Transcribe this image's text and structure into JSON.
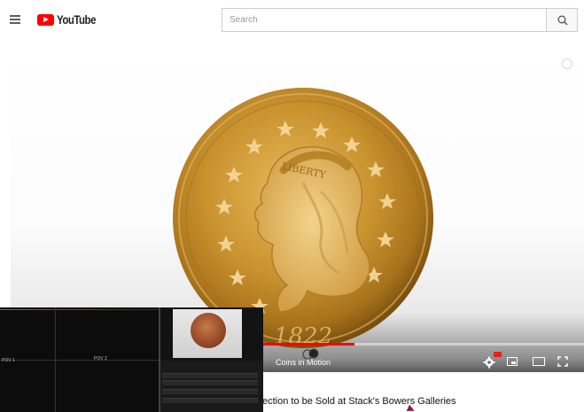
{
  "header": {
    "brand": "YouTube",
    "search_placeholder": "Search"
  },
  "player": {
    "progress_fraction": 0.6,
    "watermark": "Coins in Motion",
    "coin_year": "1822",
    "coin_inscription": "LIBERTY"
  },
  "video": {
    "title": "ection to be Sold at Stack's Bowers Galleries"
  },
  "inset": {
    "labels": [
      "POV 1",
      "POV 2"
    ]
  },
  "icons": [
    "menu-icon",
    "youtube-logo-icon",
    "search-icon",
    "info-icon",
    "settings-icon",
    "miniplayer-icon",
    "theater-icon",
    "fullscreen-icon"
  ],
  "colors": {
    "brand_red": "#ff0000",
    "progress": "#ff0000",
    "coin_gold": "#c8922e"
  }
}
